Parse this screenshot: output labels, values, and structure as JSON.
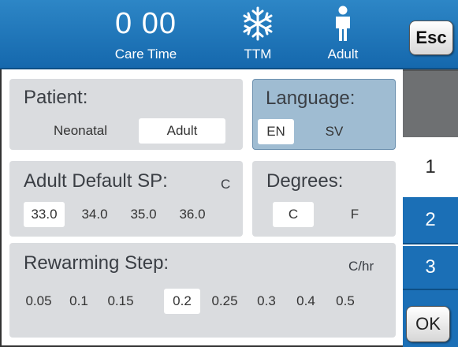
{
  "header": {
    "care_time_value": "0 00",
    "care_time_label": "Care Time",
    "ttm_label": "TTM",
    "adult_label": "Adult",
    "esc_label": "Esc",
    "icons": {
      "ttm": "snowflake-icon",
      "adult": "person-icon"
    },
    "colors": {
      "header_bg": "#1e74b9",
      "tab_bg": "#1b6fb6"
    }
  },
  "patient": {
    "title": "Patient:",
    "options": [
      "Neonatal",
      "Adult"
    ],
    "selected": "Adult"
  },
  "language": {
    "title": "Language:",
    "options": [
      "EN",
      "SV"
    ],
    "selected": "EN"
  },
  "default_sp": {
    "title": "Adult Default SP:",
    "unit": "C",
    "options": [
      "33.0",
      "34.0",
      "35.0",
      "36.0"
    ],
    "selected": "33.0"
  },
  "degrees": {
    "title": "Degrees:",
    "options": [
      "C",
      "F"
    ],
    "selected": "C"
  },
  "rewarming": {
    "title": "Rewarming Step:",
    "unit": "C/hr",
    "options": [
      "0.05",
      "0.1",
      "0.15",
      "0.2",
      "0.25",
      "0.3",
      "0.4",
      "0.5"
    ],
    "selected": "0.2"
  },
  "tabs": {
    "tab1": "1",
    "tab2": "2",
    "tab3": "3",
    "ok_label": "OK"
  }
}
